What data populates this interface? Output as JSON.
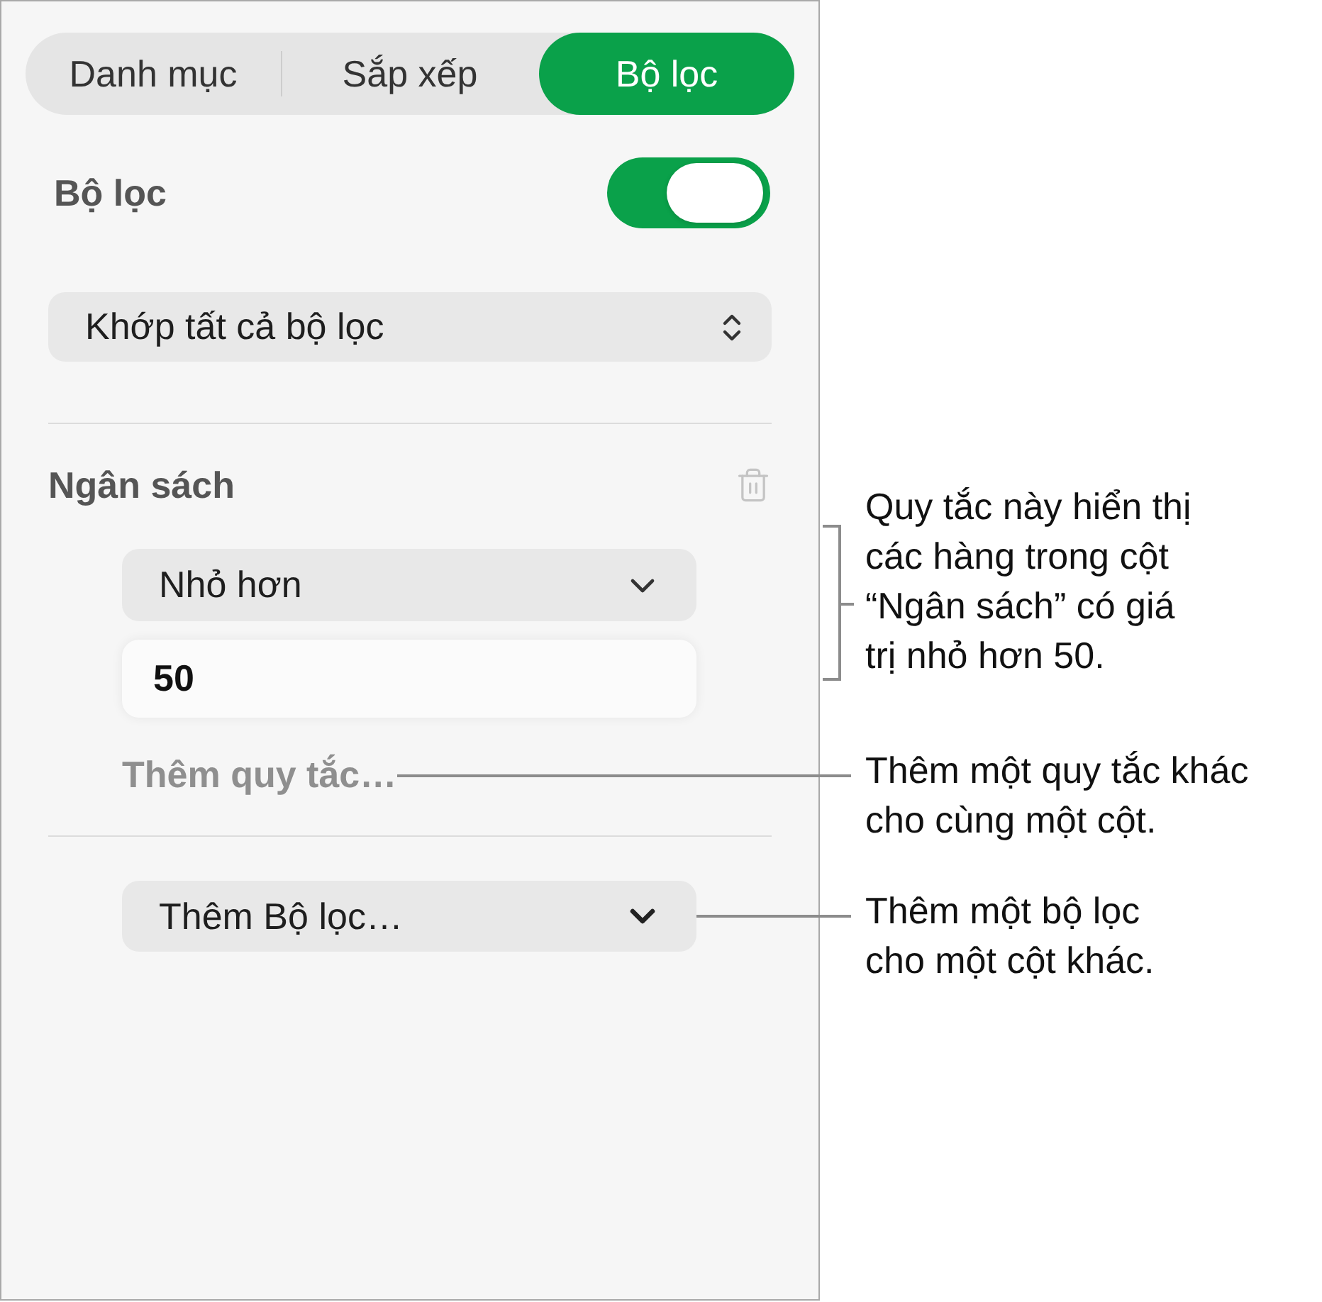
{
  "tabs": [
    {
      "label": "Danh mục",
      "selected": false
    },
    {
      "label": "Sắp xếp",
      "selected": false
    },
    {
      "label": "Bộ lọc",
      "selected": true
    }
  ],
  "filter_switch": {
    "label": "Bộ lọc",
    "on": true
  },
  "match_menu": {
    "value": "Khớp tất cả bộ lọc"
  },
  "filters": [
    {
      "column": "Ngân sách",
      "rules": [
        {
          "condition": "Nhỏ hơn",
          "value": "50"
        }
      ],
      "add_rule": "Thêm quy tắc…"
    }
  ],
  "add_filter_menu": {
    "value": "Thêm Bộ lọc…"
  },
  "callouts": [
    {
      "kind": "bracket",
      "text": "Quy tắc này hiển thị\ncác hàng trong cột\n“Ngân sách” có giá\ntrị nhỏ hơn 50."
    },
    {
      "kind": "leader",
      "text": "Thêm một quy tắc khác\ncho cùng một cột."
    },
    {
      "kind": "leader",
      "text": "Thêm một bộ lọc\ncho một cột khác."
    }
  ]
}
